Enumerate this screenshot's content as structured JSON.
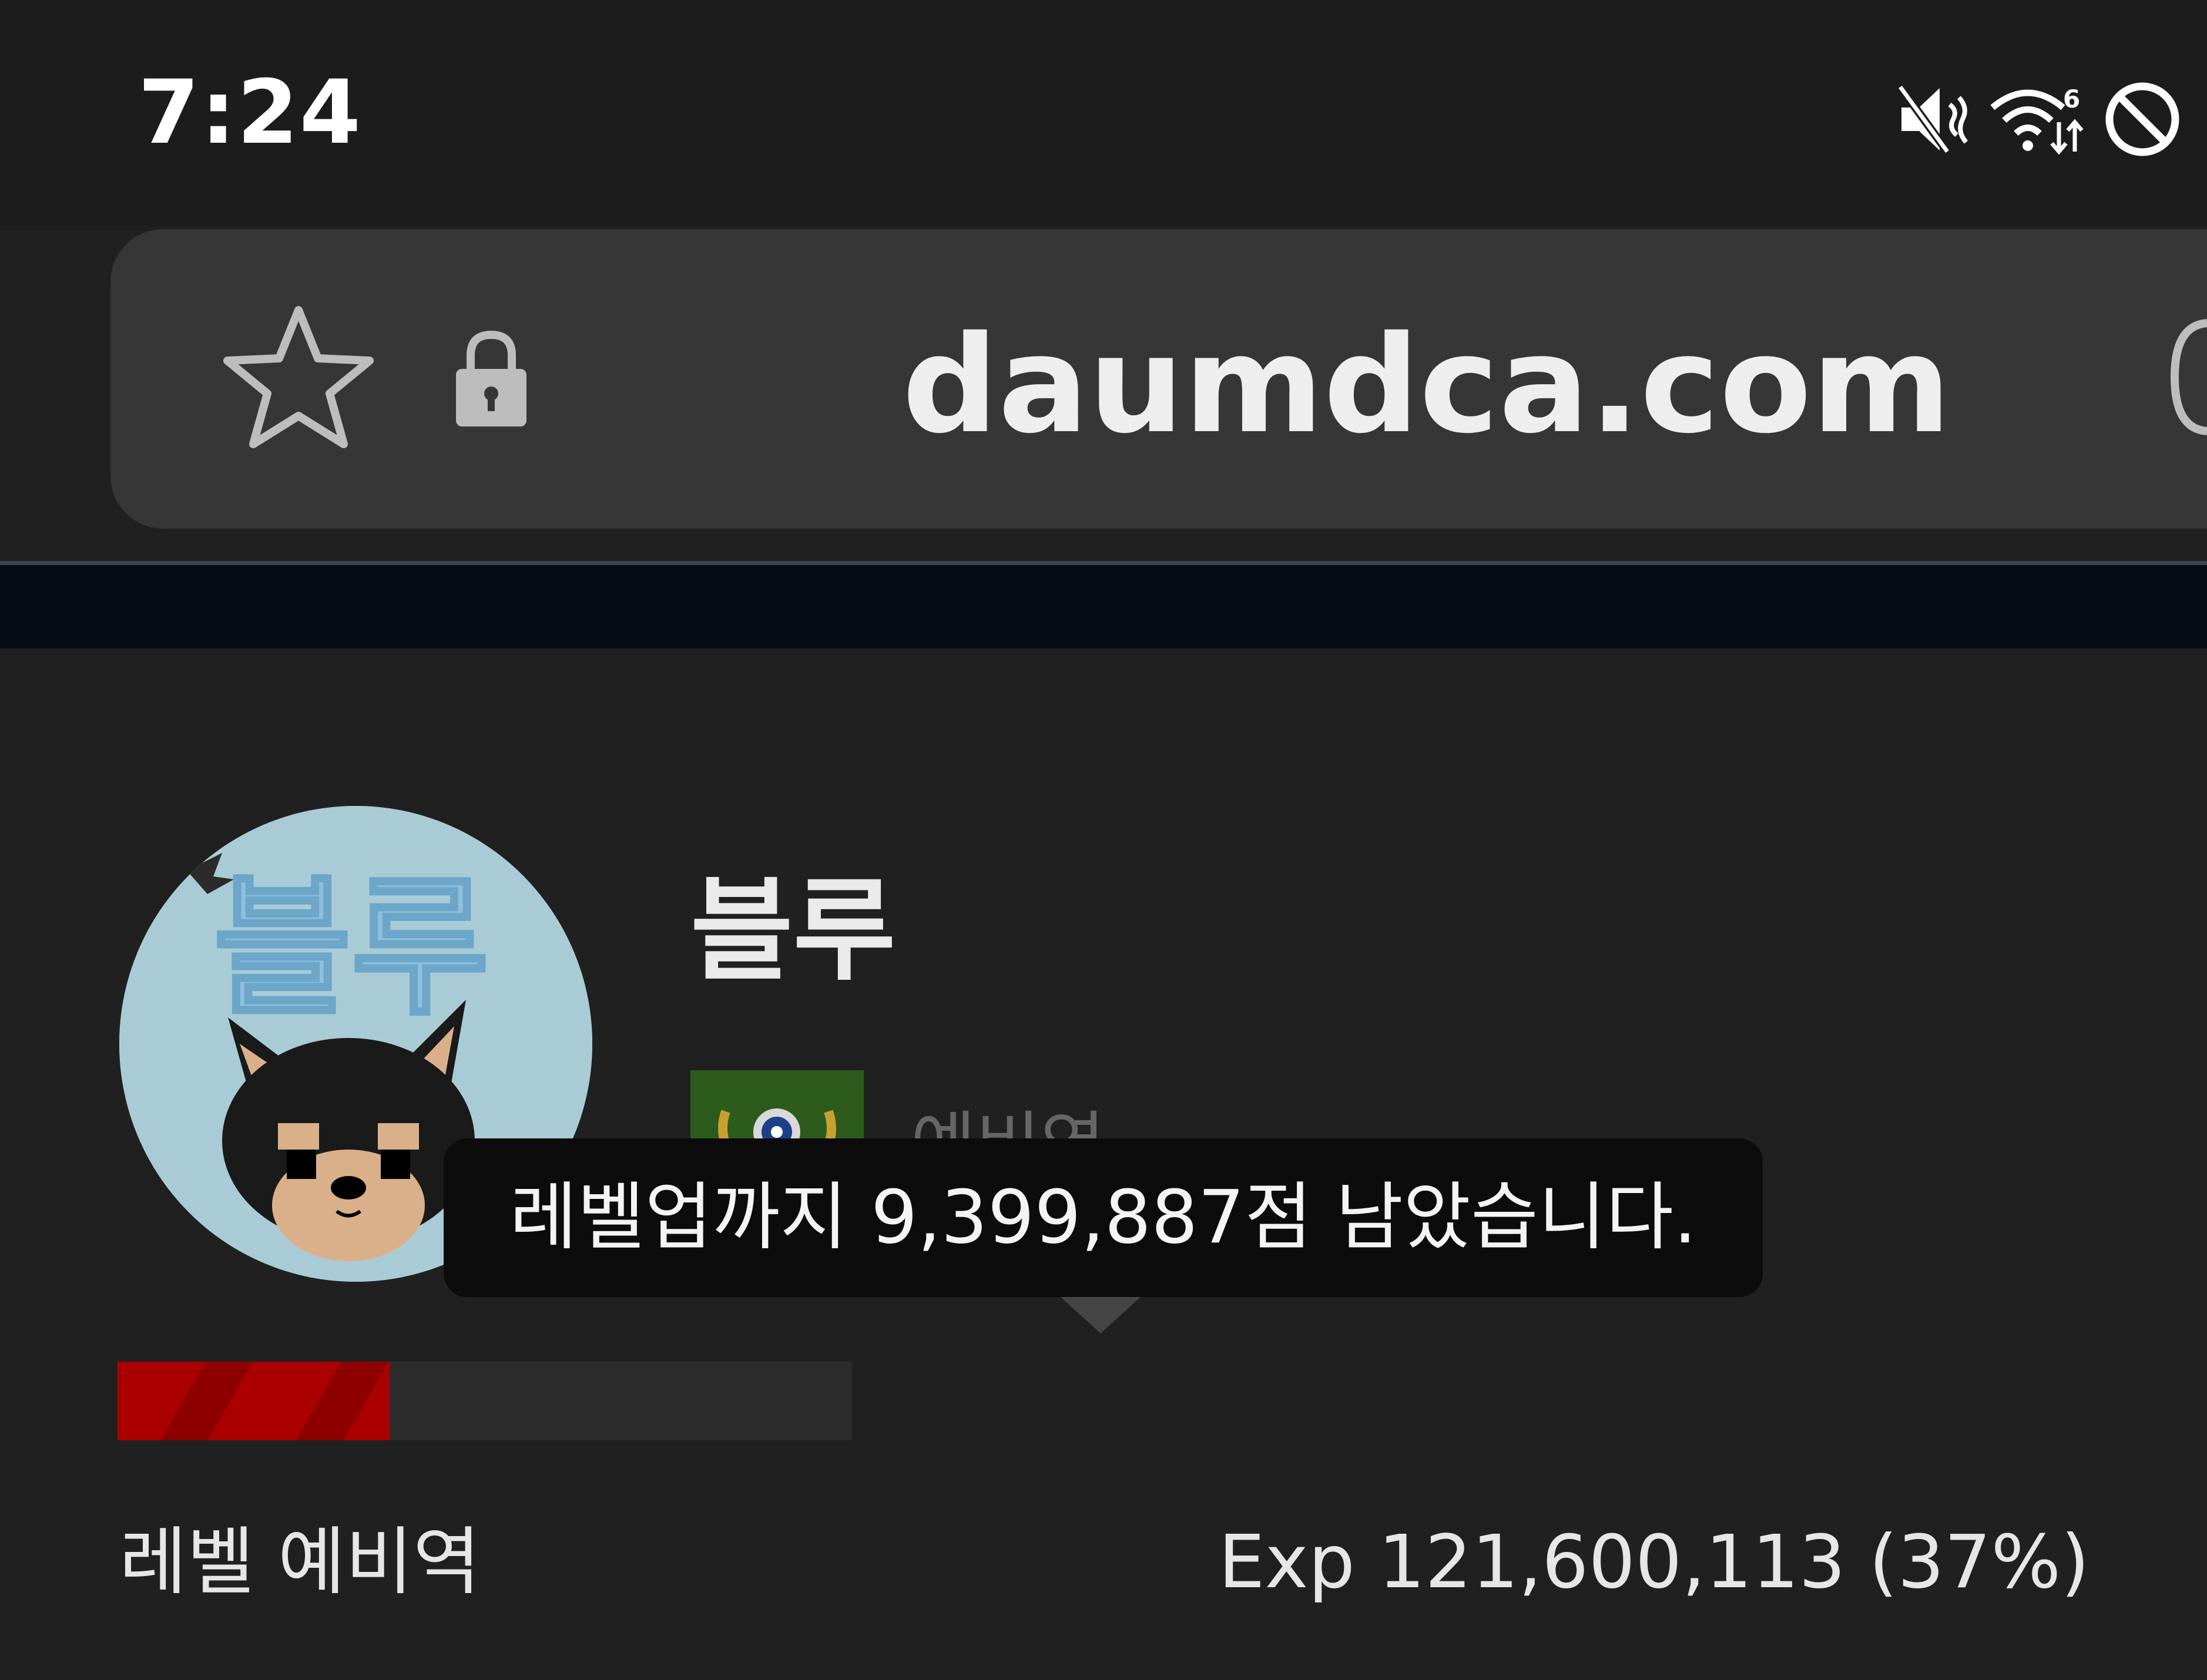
{
  "status_bar": {
    "time": "7:24",
    "icons": [
      "mute-icon",
      "wifi-6-icon",
      "do-not-disturb-icon"
    ]
  },
  "browser": {
    "url": "daumdca.com",
    "icons": [
      "star-icon",
      "lock-icon",
      "tabs-icon"
    ]
  },
  "profile": {
    "name": "블루",
    "rank": "예비역",
    "avatar_text": "블루",
    "tooltip": "레벨업까지 9,399,887점 남았습니다.",
    "level_label": "레벨 예비역",
    "exp_text": "Exp 121,600,113 (37%)",
    "exp_progress_percent": 37
  },
  "colors": {
    "background": "#202020",
    "address_bar": "#363636",
    "exp_bar": "#ab0000",
    "tooltip_bg": "#0c0c0c"
  }
}
